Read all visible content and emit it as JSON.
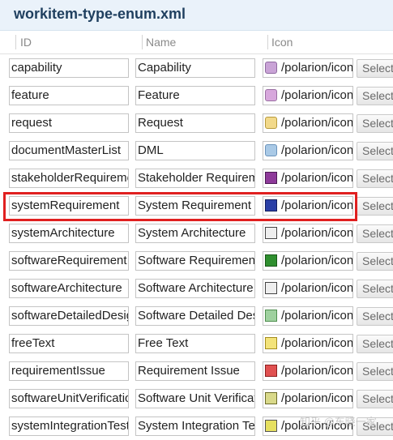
{
  "title": "workitem-type-enum.xml",
  "columns": {
    "id": "ID",
    "name": "Name",
    "icon": "Icon"
  },
  "button_label": "Select",
  "watermark": "知乎 @东晓一家",
  "rows": [
    {
      "id": "capability",
      "name": "Capability",
      "icon_path": "/polarion/icon",
      "icon_name": "capability-icon"
    },
    {
      "id": "feature",
      "name": "Feature",
      "icon_path": "/polarion/icon",
      "icon_name": "feature-icon"
    },
    {
      "id": "request",
      "name": "Request",
      "icon_path": "/polarion/icon",
      "icon_name": "request-icon"
    },
    {
      "id": "documentMasterList",
      "name": "DML",
      "icon_path": "/polarion/icon",
      "icon_name": "document-icon"
    },
    {
      "id": "stakeholderRequireme",
      "name": "Stakeholder Requirem",
      "icon_path": "/polarion/icon",
      "icon_name": "stakeholder-requirement-icon"
    },
    {
      "id": "systemRequirement",
      "name": "System Requirement",
      "icon_path": "/polarion/icon",
      "icon_name": "system-requirement-icon"
    },
    {
      "id": "systemArchitecture",
      "name": "System Architecture",
      "icon_path": "/polarion/icon",
      "icon_name": "architecture-icon"
    },
    {
      "id": "softwareRequirement",
      "name": "Software Requirement",
      "icon_path": "/polarion/icon",
      "icon_name": "software-requirement-icon"
    },
    {
      "id": "softwareArchitecture",
      "name": "Software Architecture",
      "icon_path": "/polarion/icon",
      "icon_name": "architecture-icon"
    },
    {
      "id": "softwareDetailedDesig",
      "name": "Software Detailed Des",
      "icon_path": "/polarion/icon",
      "icon_name": "detailed-design-icon"
    },
    {
      "id": "freeText",
      "name": "Free Text",
      "icon_path": "/polarion/icon",
      "icon_name": "free-text-icon"
    },
    {
      "id": "requirementIssue",
      "name": "Requirement Issue",
      "icon_path": "/polarion/icon",
      "icon_name": "issue-icon"
    },
    {
      "id": "softwareUnitVerificatio",
      "name": "Software Unit Verificat",
      "icon_path": "/polarion/icon",
      "icon_name": "verification-icon"
    },
    {
      "id": "systemIntegrationTest",
      "name": "System Integration Tes",
      "icon_path": "/polarion/icon",
      "icon_name": "integration-test-icon"
    }
  ],
  "highlighted_row_id": "systemRequirement",
  "highlight_color": "#e02020"
}
